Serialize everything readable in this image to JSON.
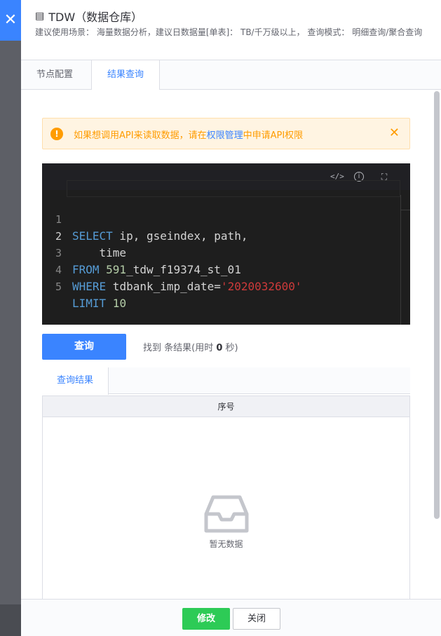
{
  "overlay": {
    "close_icon": "close-icon"
  },
  "header": {
    "title": "TDW（数据仓库）",
    "description": "建议使用场景： 海量数据分析，建议日数据量[单表]： TB/千万级以上， 查询模式： 明细查询/聚合查询"
  },
  "tabs": [
    {
      "label": "节点配置"
    },
    {
      "label": "结果查询"
    }
  ],
  "alert": {
    "text_before": "如果想调用API来读取数据，请在",
    "link": "权限管理",
    "text_after": "中申请API权限",
    "close": "✕"
  },
  "editor": {
    "toolbar": [
      "code-icon",
      "info-icon",
      "fullscreen-icon"
    ],
    "line_numbers": [
      "1",
      "2",
      "3",
      "4",
      "5"
    ],
    "lines": [
      {
        "kw": "SELECT",
        "rest": " ip, gseindex, path,"
      },
      {
        "kw": "",
        "rest": "    time"
      },
      {
        "kw": "FROM",
        "num": " 591",
        "rest": "_tdw_f19374_st_01"
      },
      {
        "kw": "WHERE",
        "rest": " tdbank_imp_date=",
        "str": "'2020032600'"
      },
      {
        "kw": "LIMIT",
        "num": " 10"
      }
    ]
  },
  "query": {
    "button": "查询",
    "summary_prefix": "找到 条结果(用时 ",
    "summary_time": "0",
    "summary_suffix": " 秒)"
  },
  "results": {
    "tab": "查询结果",
    "column": "序号",
    "empty_text": "暂无数据"
  },
  "footer": {
    "save": "修改",
    "close": "关闭"
  },
  "colors": {
    "primary": "#3a84ff",
    "success": "#2dcb56",
    "warning": "#ff9c01"
  }
}
